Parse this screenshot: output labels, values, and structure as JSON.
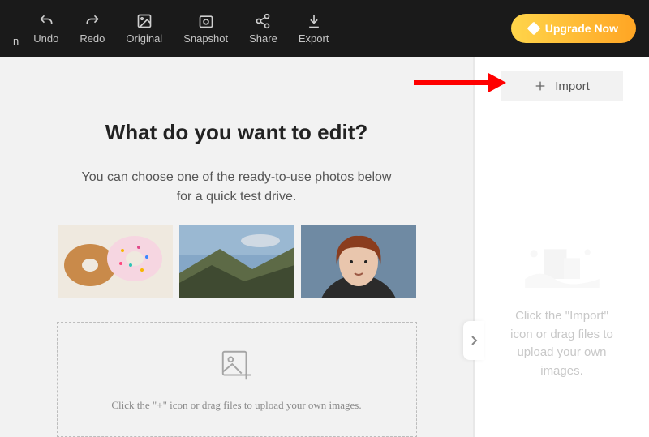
{
  "toolbar": {
    "corner": "n",
    "undo": "Undo",
    "redo": "Redo",
    "original": "Original",
    "snapshot": "Snapshot",
    "share": "Share",
    "export": "Export",
    "upgrade": "Upgrade Now"
  },
  "main": {
    "headline": "What do you want to edit?",
    "subheadline_l1": "You can choose one of the ready-to-use photos below",
    "subheadline_l2": "for a quick test drive.",
    "dropzone_hint": "Click the \"+\" icon or drag files to upload your own images."
  },
  "side": {
    "import": "Import",
    "hint_l1": "Click the \"Import\"",
    "hint_l2": "icon or drag files to",
    "hint_l3": "upload your own",
    "hint_l4": "images."
  }
}
